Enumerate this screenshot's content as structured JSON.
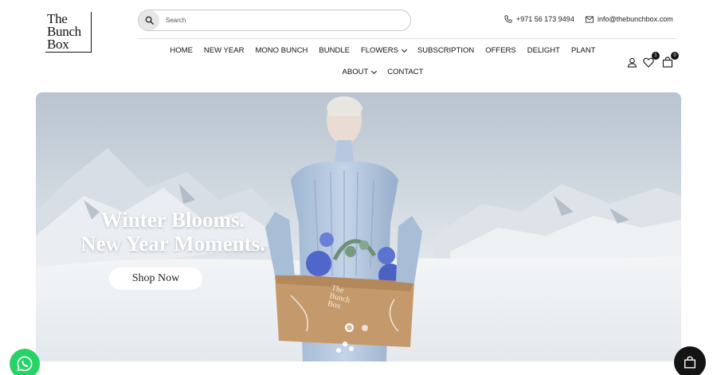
{
  "brand": {
    "logo_line1": "The",
    "logo_line2": "Bunch",
    "logo_line3": "Box"
  },
  "search": {
    "placeholder": "Search",
    "icon": "search-icon"
  },
  "contacts": {
    "phone": "+971 56 173 9494",
    "email": "info@thebunchbox.com"
  },
  "nav": {
    "items": [
      {
        "label": "HOME"
      },
      {
        "label": "NEW YEAR"
      },
      {
        "label": "MONO BUNCH"
      },
      {
        "label": "BUNDLE"
      },
      {
        "label": "FLOWERS"
      },
      {
        "label": "SUBSCRIPTION"
      },
      {
        "label": "OFFERS"
      },
      {
        "label": "DELIGHT"
      },
      {
        "label": "PLANT"
      },
      {
        "label": "ABOUT"
      },
      {
        "label": "CONTACT"
      }
    ]
  },
  "header_icons": {
    "wishlist_count": "1",
    "cart_count": "0"
  },
  "hero": {
    "title_line1": "Winter Blooms.",
    "title_line2": "New Year Moments.",
    "cta_label": "Shop Now",
    "box_line1": "The",
    "box_line2": "Bunch",
    "box_line3": "Box",
    "slide_count": 2,
    "active_slide": 1
  },
  "colors": {
    "accent": "#111111",
    "whatsapp": "#25d366",
    "hero_sky": "#c6cfd8"
  }
}
